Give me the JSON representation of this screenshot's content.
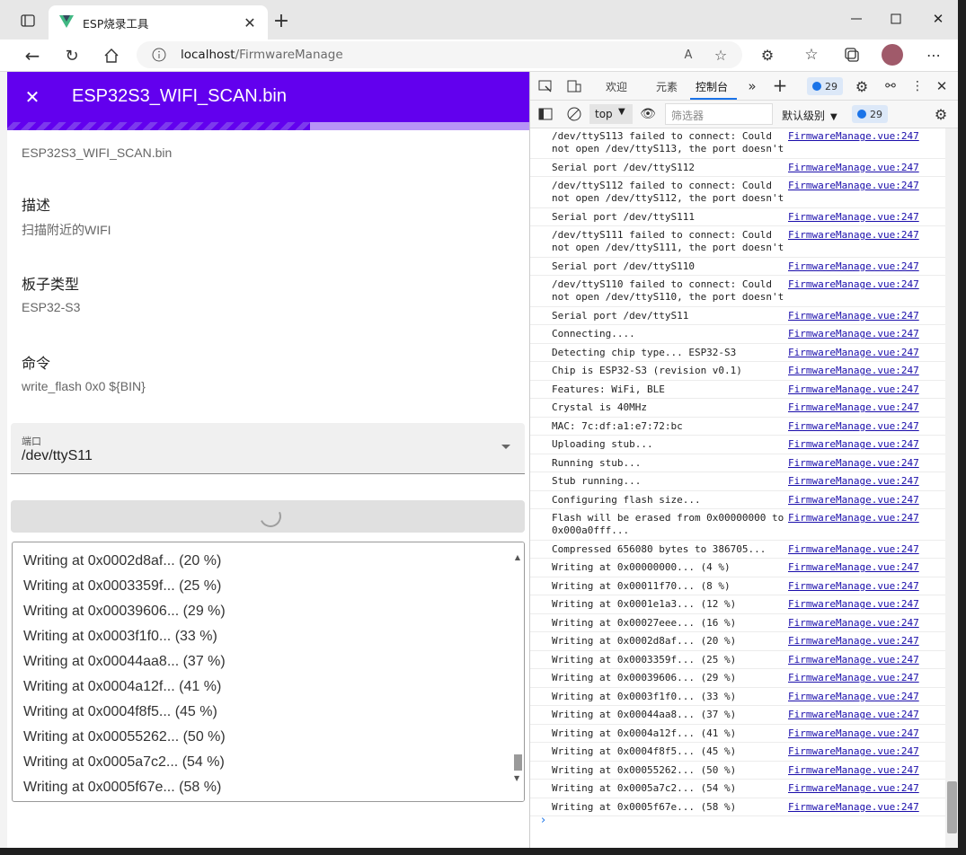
{
  "browser": {
    "tab_title": "ESP烧录工具",
    "url_host": "localhost",
    "url_path": "/FirmwareManage"
  },
  "app": {
    "header_title": "ESP32S3_WIFI_SCAN.bin",
    "filename": "ESP32S3_WIFI_SCAN.bin",
    "desc_label": "描述",
    "desc_value": "扫描附近的WIFI",
    "board_label": "板子类型",
    "board_value": "ESP32-S3",
    "cmd_label": "命令",
    "cmd_value": "write_flash 0x0 ${BIN}",
    "port_label": "端口",
    "port_value": "/dev/ttyS11",
    "progress": 0.58
  },
  "log": [
    "Writing at 0x0002d8af... (20 %)",
    "Writing at 0x0003359f... (25 %)",
    "Writing at 0x00039606... (29 %)",
    "Writing at 0x0003f1f0... (33 %)",
    "Writing at 0x00044aa8... (37 %)",
    "Writing at 0x0004a12f... (41 %)",
    "Writing at 0x0004f8f5... (45 %)",
    "Writing at 0x00055262... (50 %)",
    "Writing at 0x0005a7c2... (54 %)",
    "Writing at 0x0005f67e... (58 %)"
  ],
  "devtools": {
    "tabs": [
      "欢迎",
      "元素",
      "控制台"
    ],
    "issues": "29",
    "context": "top",
    "filter_placeholder": "筛选器",
    "level": "默认级别",
    "source": "FirmwareManage.vue:247",
    "messages": [
      "/dev/ttyS113 failed to connect: Could\nnot open /dev/ttyS113, the port doesn't exist",
      "Serial port /dev/ttyS112",
      "/dev/ttyS112 failed to connect: Could\nnot open /dev/ttyS112, the port doesn't exist",
      "Serial port /dev/ttyS111",
      "/dev/ttyS111 failed to connect: Could\nnot open /dev/ttyS111, the port doesn't exist",
      "Serial port /dev/ttyS110",
      "/dev/ttyS110 failed to connect: Could\nnot open /dev/ttyS110, the port doesn't exist",
      "Serial port /dev/ttyS11",
      "Connecting....",
      "Detecting chip type... ESP32-S3",
      "Chip is ESP32-S3 (revision v0.1)",
      "Features: WiFi, BLE",
      "Crystal is 40MHz",
      "MAC: 7c:df:a1:e7:72:bc",
      "Uploading stub...",
      "Running stub...",
      "Stub running...",
      "Configuring flash size...",
      "Flash will be erased from 0x00000000 to\n0x000a0fff...",
      "Compressed 656080 bytes to 386705...",
      "Writing at 0x00000000... (4 %)",
      "Writing at 0x00011f70... (8 %)",
      "Writing at 0x0001e1a3... (12 %)",
      "Writing at 0x00027eee... (16 %)",
      "Writing at 0x0002d8af... (20 %)",
      "Writing at 0x0003359f... (25 %)",
      "Writing at 0x00039606... (29 %)",
      "Writing at 0x0003f1f0... (33 %)",
      "Writing at 0x00044aa8... (37 %)",
      "Writing at 0x0004a12f... (41 %)",
      "Writing at 0x0004f8f5... (45 %)",
      "Writing at 0x00055262... (50 %)",
      "Writing at 0x0005a7c2... (54 %)",
      "Writing at 0x0005f67e... (58 %)"
    ]
  }
}
